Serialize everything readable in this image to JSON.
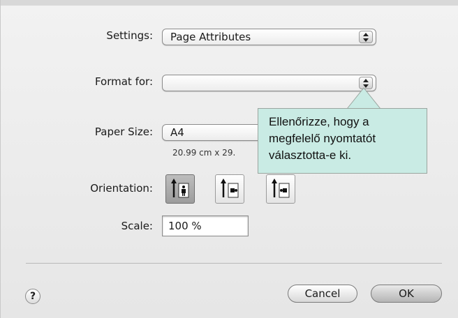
{
  "settings": {
    "label": "Settings:",
    "value": "Page Attributes"
  },
  "format_for": {
    "label": "Format for:",
    "value": ""
  },
  "paper_size": {
    "label": "Paper Size:",
    "value": "A4",
    "dimensions": "20.99 cm x 29."
  },
  "orientation": {
    "label": "Orientation:",
    "options": [
      {
        "icon": "portrait-orientation-icon",
        "selected": true
      },
      {
        "icon": "landscape-orientation-icon",
        "selected": false
      },
      {
        "icon": "reverse-landscape-orientation-icon",
        "selected": false
      }
    ]
  },
  "scale": {
    "label": "Scale:",
    "value": "100 %"
  },
  "buttons": {
    "help": "?",
    "cancel": "Cancel",
    "ok": "OK"
  },
  "tooltip": {
    "lines": [
      "Ellenőrizze, hogy a",
      "megfelelő nyomtatót",
      "választotta-e ki."
    ]
  }
}
